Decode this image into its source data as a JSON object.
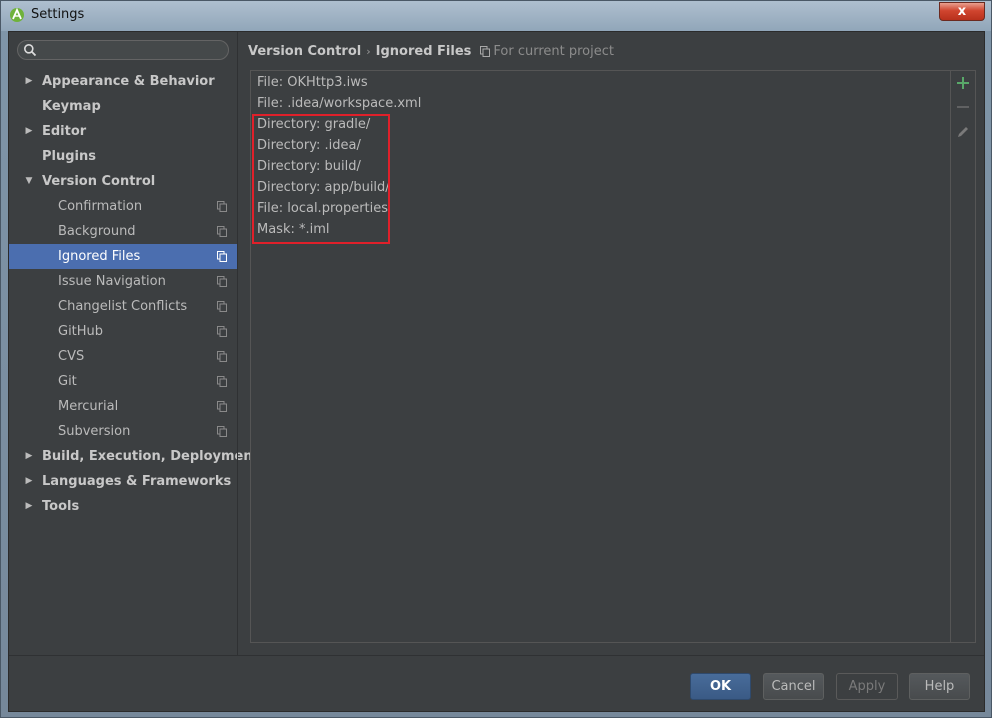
{
  "window": {
    "title": "Settings",
    "close_label": "x"
  },
  "sidebar": {
    "search_placeholder": "",
    "items": [
      {
        "label": "Appearance & Behavior",
        "level": 0,
        "arrow": "▶"
      },
      {
        "label": "Keymap",
        "level": 0,
        "arrow": ""
      },
      {
        "label": "Editor",
        "level": 0,
        "arrow": "▶"
      },
      {
        "label": "Plugins",
        "level": 0,
        "arrow": ""
      },
      {
        "label": "Version Control",
        "level": 0,
        "arrow": "▼"
      },
      {
        "label": "Confirmation",
        "level": 1
      },
      {
        "label": "Background",
        "level": 1
      },
      {
        "label": "Ignored Files",
        "level": 1,
        "selected": true
      },
      {
        "label": "Issue Navigation",
        "level": 1
      },
      {
        "label": "Changelist Conflicts",
        "level": 1
      },
      {
        "label": "GitHub",
        "level": 1
      },
      {
        "label": "CVS",
        "level": 1
      },
      {
        "label": "Git",
        "level": 1
      },
      {
        "label": "Mercurial",
        "level": 1
      },
      {
        "label": "Subversion",
        "level": 1
      },
      {
        "label": "Build, Execution, Deployment",
        "level": 0,
        "arrow": "▶"
      },
      {
        "label": "Languages & Frameworks",
        "level": 0,
        "arrow": "▶"
      },
      {
        "label": "Tools",
        "level": 0,
        "arrow": "▶"
      }
    ]
  },
  "breadcrumb": {
    "parent": "Version Control",
    "separator": "›",
    "current": "Ignored Files",
    "scope": "For current project"
  },
  "ignored_files": [
    "File: OKHttp3.iws",
    "File: .idea/workspace.xml",
    "Directory: gradle/",
    "Directory: .idea/",
    "Directory: build/",
    "Directory: app/build/",
    "File: local.properties",
    "Mask: *.iml"
  ],
  "buttons": {
    "ok": "OK",
    "cancel": "Cancel",
    "apply": "Apply",
    "help": "Help"
  },
  "colors": {
    "background": "#3c3f41",
    "selection": "#4b6eaf",
    "highlight_box": "#e0202a",
    "add_icon": "#59a869"
  }
}
